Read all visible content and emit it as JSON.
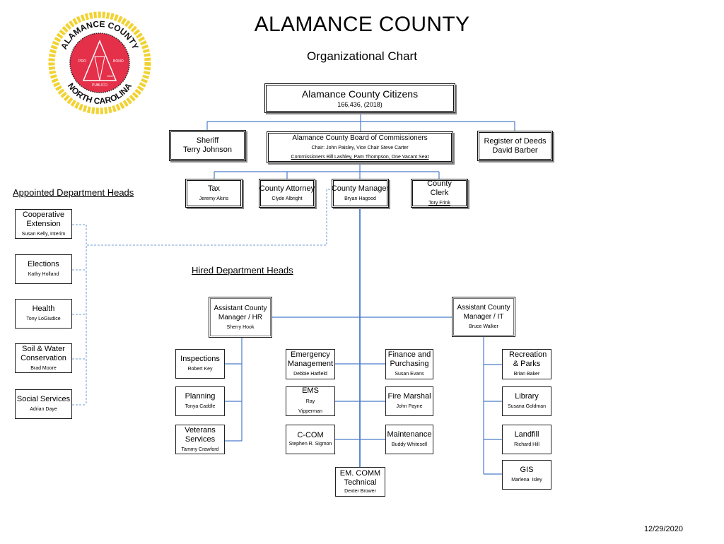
{
  "header": {
    "title": "ALAMANCE COUNTY",
    "subtitle": "Organizational Chart",
    "date": "12/29/2020"
  },
  "seal": {
    "top_text": "ALAMANCE COUNTY",
    "bottom_text": "NORTH CAROLINA",
    "left_word": "PRO",
    "right_word": "BONO",
    "bottom_word": "PUBLICO",
    "year": "1849",
    "colors": {
      "rope": "#f2d230",
      "center": "#e5304a",
      "text": "#111111"
    }
  },
  "colors": {
    "connector": "#4a7cc9",
    "dotted": "#8fb0dd",
    "border": "#222222"
  },
  "top": {
    "citizens": {
      "title": "Alamance County Citizens",
      "sub": "166,436, (2018)"
    },
    "sheriff": {
      "title": "Sheriff",
      "name": "Terry Johnson"
    },
    "board": {
      "title": "Alamance County Board of Commissioners",
      "line1": "Chair: John Paisley, Vice Chair Steve Carter",
      "line2": "Commissioners Bill Lashley, Pam Thompson, One Vacant Seat"
    },
    "register": {
      "title": "Register of Deeds",
      "name": "David Barber"
    }
  },
  "board_reports": [
    {
      "title": "Tax",
      "name": "Jeremy Akins"
    },
    {
      "title": "County Attorney",
      "name": "Clyde Albright"
    },
    {
      "title": "County Manager",
      "name": "Bryan Hagood"
    },
    {
      "title": "County Clerk",
      "name": "Tory Frink"
    }
  ],
  "appointed": {
    "heading": "Appointed Department Heads",
    "items": [
      {
        "title": "Cooperative Extension",
        "name": "Susan Kelly, Interim"
      },
      {
        "title": "Elections",
        "name": "Kathy Holland"
      },
      {
        "title": "Health",
        "name": "Tony LoGiudice"
      },
      {
        "title": "Soil & Water Conservation",
        "name": "Brad Moore"
      },
      {
        "title": "Social Services",
        "name": "Adrian Daye"
      }
    ]
  },
  "hired": {
    "heading": "Hired Department Heads",
    "acm_hr": {
      "title": "Assistant County Manager / HR",
      "name": "Sherry Hook"
    },
    "acm_it": {
      "title": "Assistant County Manager / IT",
      "name": "Bruce Walker"
    },
    "hr_reports": [
      {
        "title": "Inspections",
        "name": "Robert Key"
      },
      {
        "title": "Planning",
        "name": "Tonya Caddle"
      },
      {
        "title": "Veterans Services",
        "name": "Tammy Crawford"
      }
    ],
    "manager_left": [
      {
        "title": "Emergency Management",
        "name": "Debbie Hatfield"
      },
      {
        "title": "EMS",
        "name": "Ray Vipperman"
      },
      {
        "title": "C-COM",
        "name": "Stephen R. Sigmon"
      }
    ],
    "manager_right": [
      {
        "title": "Finance and Purchasing",
        "name": "Susan Evans"
      },
      {
        "title": "Fire Marshal",
        "name": "John Payne"
      },
      {
        "title": "Maintenance",
        "name": "Buddy Whitesell"
      }
    ],
    "manager_bottom": {
      "title": "EM. COMM Technical",
      "name": "Dexter Brower"
    },
    "it_reports": [
      {
        "title": "Recreation & Parks",
        "name": "Brian Baker"
      },
      {
        "title": "Library",
        "name": "Susana Goldman"
      },
      {
        "title": "Landfill",
        "name": "Richard Hill"
      },
      {
        "title": "GIS",
        "name": "Marlena  Isley"
      }
    ]
  }
}
